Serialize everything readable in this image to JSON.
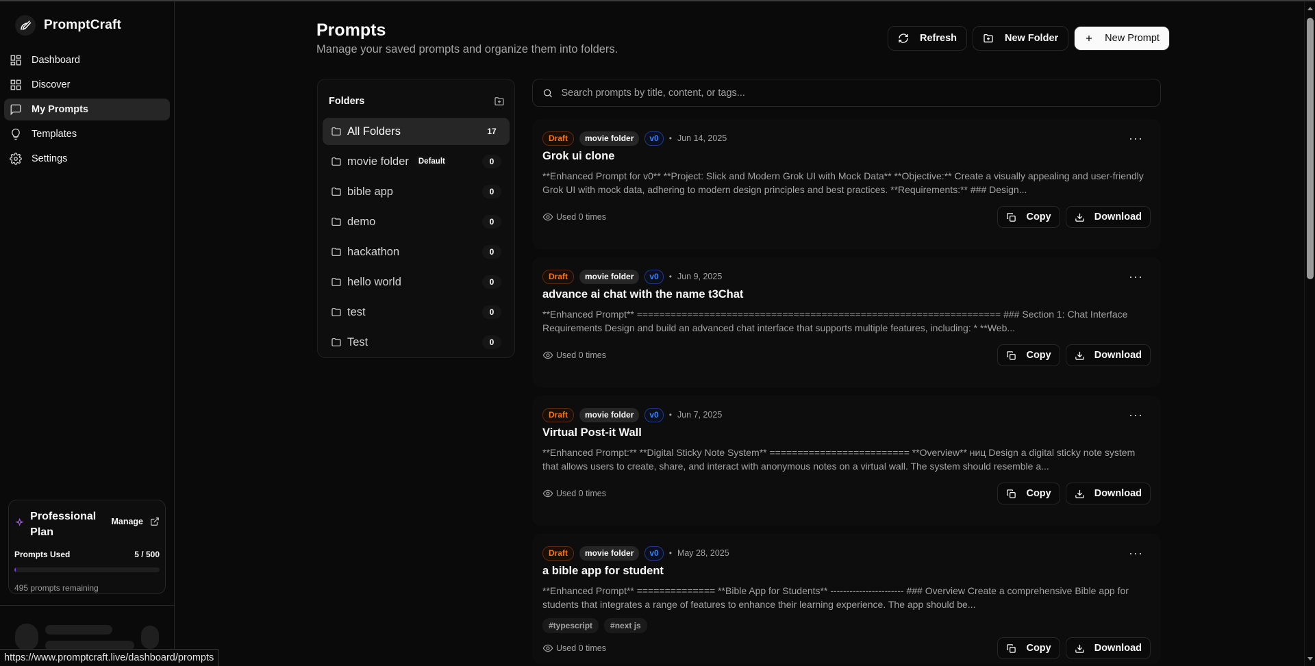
{
  "brand": {
    "name": "PromptCraft"
  },
  "nav": [
    {
      "label": "Dashboard",
      "icon": "dashboard-icon"
    },
    {
      "label": "Discover",
      "icon": "grid-icon"
    },
    {
      "label": "My Prompts",
      "icon": "message-square-icon",
      "active": true
    },
    {
      "label": "Templates",
      "icon": "lightbulb-icon"
    },
    {
      "label": "Settings",
      "icon": "gear-icon"
    }
  ],
  "plan": {
    "title": "Professional Plan",
    "manage_label": "Manage",
    "used_label": "Prompts Used",
    "used_value": "5 / 500",
    "used_fraction": 0.01,
    "remaining": "495 prompts remaining"
  },
  "header": {
    "title": "Prompts",
    "subtitle": "Manage your saved prompts and organize them into folders.",
    "refresh_label": "Refresh",
    "new_folder_label": "New Folder",
    "new_prompt_label": "New Prompt"
  },
  "folders": {
    "title": "Folders",
    "items": [
      {
        "name": "All Folders",
        "count": "17",
        "active": true
      },
      {
        "name": "movie folder",
        "badge": "Default",
        "count": "0"
      },
      {
        "name": "bible app",
        "count": "0"
      },
      {
        "name": "demo",
        "count": "0"
      },
      {
        "name": "hackathon",
        "count": "0"
      },
      {
        "name": "hello world",
        "count": "0"
      },
      {
        "name": "test",
        "count": "0"
      },
      {
        "name": "Test",
        "count": "0"
      }
    ]
  },
  "search": {
    "placeholder": "Search prompts by title, content, or tags..."
  },
  "prompts": [
    {
      "status": "Draft",
      "folder": "movie folder",
      "version": "v0",
      "date": "Jun 14, 2025",
      "title": "Grok ui clone",
      "body": "**Enhanced Prompt for v0** **Project: Slick and Modern Grok UI with Mock Data** **Objective:** Create a visually appealing and user-friendly Grok UI with mock data, adhering to modern design principles and best practices. **Requirements:** ### Design...",
      "tags": [],
      "used": "Used 0 times",
      "copy_label": "Copy",
      "download_label": "Download"
    },
    {
      "status": "Draft",
      "folder": "movie folder",
      "version": "v0",
      "date": "Jun 9, 2025",
      "title": "advance ai chat with the name t3Chat",
      "body": "**Enhanced Prompt** ================================================================= ### Section 1: Chat Interface Requirements Design and build an advanced chat interface that supports multiple features, including: * **Web...",
      "tags": [],
      "used": "Used 0 times",
      "copy_label": "Copy",
      "download_label": "Download"
    },
    {
      "status": "Draft",
      "folder": "movie folder",
      "version": "v0",
      "date": "Jun 7, 2025",
      "title": "Virtual Post-it Wall",
      "body": "**Enhanced Prompt:** **Digital Sticky Note System** ========================= **Overview** ниц Design a digital sticky note system that allows users to create, share, and interact with anonymous notes on a virtual wall. The system should resemble a...",
      "tags": [],
      "used": "Used 0 times",
      "copy_label": "Copy",
      "download_label": "Download"
    },
    {
      "status": "Draft",
      "folder": "movie folder",
      "version": "v0",
      "date": "May 28, 2025",
      "title": "a bible app for student",
      "body": "**Enhanced Prompt** ============== **Bible App for Students** ----------------------- ### Overview Create a comprehensive Bible app for students that integrates a range of features to enhance their learning experience. The app should be...",
      "tags": [
        "#typescript",
        "#next js"
      ],
      "used": "Used 0 times",
      "copy_label": "Copy",
      "download_label": "Download"
    }
  ],
  "status_url": "https://www.promptcraft.live/dashboard/prompts",
  "colors": {
    "accent": "#7c3aed",
    "draft": "#f97316",
    "version": "#3b82f6",
    "background": "#0a0a0a"
  }
}
